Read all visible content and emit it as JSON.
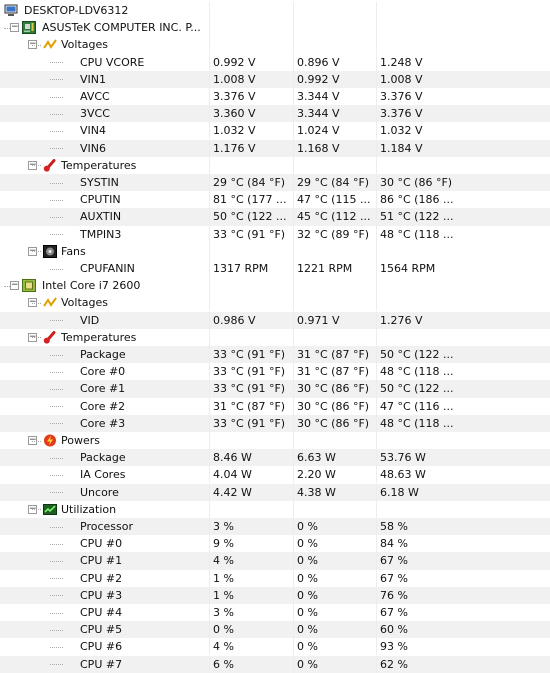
{
  "computer": {
    "name": "DESKTOP-LDV6312",
    "icon": "computer-icon"
  },
  "devices": [
    {
      "name": "ASUSTeK COMPUTER INC. P...",
      "icon": "motherboard-icon",
      "groups": [
        {
          "name": "Voltages",
          "icon": "voltage-icon",
          "items": [
            {
              "label": "CPU VCORE",
              "values": [
                "0.992 V",
                "0.896 V",
                "1.248 V"
              ]
            },
            {
              "label": "VIN1",
              "values": [
                "1.008 V",
                "0.992 V",
                "1.008 V"
              ]
            },
            {
              "label": "AVCC",
              "values": [
                "3.376 V",
                "3.344 V",
                "3.376 V"
              ]
            },
            {
              "label": "3VCC",
              "values": [
                "3.360 V",
                "3.344 V",
                "3.376 V"
              ]
            },
            {
              "label": "VIN4",
              "values": [
                "1.032 V",
                "1.024 V",
                "1.032 V"
              ]
            },
            {
              "label": "VIN6",
              "values": [
                "1.176 V",
                "1.168 V",
                "1.184 V"
              ]
            }
          ]
        },
        {
          "name": "Temperatures",
          "icon": "thermometer-icon",
          "items": [
            {
              "label": "SYSTIN",
              "values": [
                "29 °C  (84 °F)",
                "29 °C  (84 °F)",
                "30 °C  (86 °F)"
              ]
            },
            {
              "label": "CPUTIN",
              "values": [
                "81 °C  (177 ...",
                "47 °C  (115 ...",
                "86 °C  (186 ..."
              ]
            },
            {
              "label": "AUXTIN",
              "values": [
                "50 °C  (122 ...",
                "45 °C  (112 ...",
                "51 °C  (122 ..."
              ]
            },
            {
              "label": "TMPIN3",
              "values": [
                "33 °C  (91 °F)",
                "32 °C  (89 °F)",
                "48 °C  (118 ..."
              ]
            }
          ]
        },
        {
          "name": "Fans",
          "icon": "fan-icon",
          "items": [
            {
              "label": "CPUFANIN",
              "values": [
                "1317 RPM",
                "1221 RPM",
                "1564 RPM"
              ]
            }
          ]
        }
      ]
    },
    {
      "name": "Intel Core i7 2600",
      "icon": "cpu-chip-icon",
      "groups": [
        {
          "name": "Voltages",
          "icon": "voltage-icon",
          "items": [
            {
              "label": "VID",
              "values": [
                "0.986 V",
                "0.971 V",
                "1.276 V"
              ]
            }
          ]
        },
        {
          "name": "Temperatures",
          "icon": "thermometer-icon",
          "items": [
            {
              "label": "Package",
              "values": [
                "33 °C  (91 °F)",
                "31 °C  (87 °F)",
                "50 °C  (122 ..."
              ]
            },
            {
              "label": "Core #0",
              "values": [
                "33 °C  (91 °F)",
                "31 °C  (87 °F)",
                "48 °C  (118 ..."
              ]
            },
            {
              "label": "Core #1",
              "values": [
                "33 °C  (91 °F)",
                "30 °C  (86 °F)",
                "50 °C  (122 ..."
              ]
            },
            {
              "label": "Core #2",
              "values": [
                "31 °C  (87 °F)",
                "30 °C  (86 °F)",
                "47 °C  (116 ..."
              ]
            },
            {
              "label": "Core #3",
              "values": [
                "33 °C  (91 °F)",
                "30 °C  (86 °F)",
                "48 °C  (118 ..."
              ]
            }
          ]
        },
        {
          "name": "Powers",
          "icon": "power-icon",
          "items": [
            {
              "label": "Package",
              "values": [
                "8.46 W",
                "6.63 W",
                "53.76 W"
              ]
            },
            {
              "label": "IA Cores",
              "values": [
                "4.04 W",
                "2.20 W",
                "48.63 W"
              ]
            },
            {
              "label": "Uncore",
              "values": [
                "4.42 W",
                "4.38 W",
                "6.18 W"
              ]
            }
          ]
        },
        {
          "name": "Utilization",
          "icon": "utilization-icon",
          "items": [
            {
              "label": "Processor",
              "values": [
                "3 %",
                "0 %",
                "58 %"
              ]
            },
            {
              "label": "CPU #0",
              "values": [
                "9 %",
                "0 %",
                "84 %"
              ]
            },
            {
              "label": "CPU #1",
              "values": [
                "4 %",
                "0 %",
                "67 %"
              ]
            },
            {
              "label": "CPU #2",
              "values": [
                "1 %",
                "0 %",
                "67 %"
              ]
            },
            {
              "label": "CPU #3",
              "values": [
                "1 %",
                "0 %",
                "76 %"
              ]
            },
            {
              "label": "CPU #4",
              "values": [
                "3 %",
                "0 %",
                "67 %"
              ]
            },
            {
              "label": "CPU #5",
              "values": [
                "0 %",
                "0 %",
                "60 %"
              ]
            },
            {
              "label": "CPU #6",
              "values": [
                "4 %",
                "0 %",
                "93 %"
              ]
            },
            {
              "label": "CPU #7",
              "values": [
                "6 %",
                "0 %",
                "62 %"
              ]
            }
          ]
        }
      ]
    }
  ]
}
